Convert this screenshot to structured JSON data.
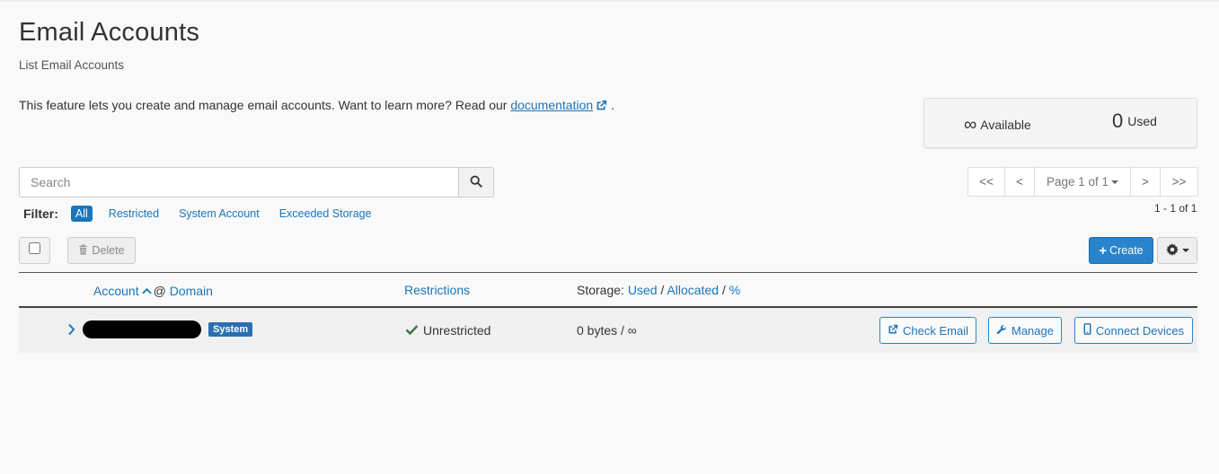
{
  "header": {
    "title": "Email Accounts",
    "subtitle": "List Email Accounts"
  },
  "intro": {
    "text": "This feature lets you create and manage email accounts. Want to learn more? Read our",
    "link_label": "documentation",
    "suffix": "."
  },
  "stats": {
    "available_symbol": "∞",
    "available_label": "Available",
    "used_value": "0",
    "used_label": "Used"
  },
  "search": {
    "placeholder": "Search"
  },
  "filter": {
    "label": "Filter:",
    "options": [
      "All",
      "Restricted",
      "System Account",
      "Exceeded Storage"
    ],
    "active": "All"
  },
  "pager": {
    "first": "<<",
    "prev": "<",
    "page_label": "Page 1 of 1",
    "next": ">",
    "last": ">>",
    "count": "1 - 1 of 1"
  },
  "toolbar": {
    "delete_label": "Delete",
    "create_label": "Create"
  },
  "table": {
    "headers": {
      "account": "Account",
      "at": "@",
      "domain": "Domain",
      "restrictions": "Restrictions",
      "storage_prefix": "Storage:",
      "storage_used": "Used",
      "storage_sep1": "/",
      "storage_allocated": "Allocated",
      "storage_sep2": "/",
      "storage_percent": "%"
    },
    "rows": [
      {
        "badge": "System",
        "restriction": "Unrestricted",
        "storage": "0 bytes / ∞",
        "actions": [
          "Check Email",
          "Manage",
          "Connect Devices"
        ]
      }
    ]
  },
  "colors": {
    "accent": "#1b75bb",
    "primary_button": "#2a84cc",
    "badge": "#2a6fb0",
    "success": "#3c763d"
  }
}
